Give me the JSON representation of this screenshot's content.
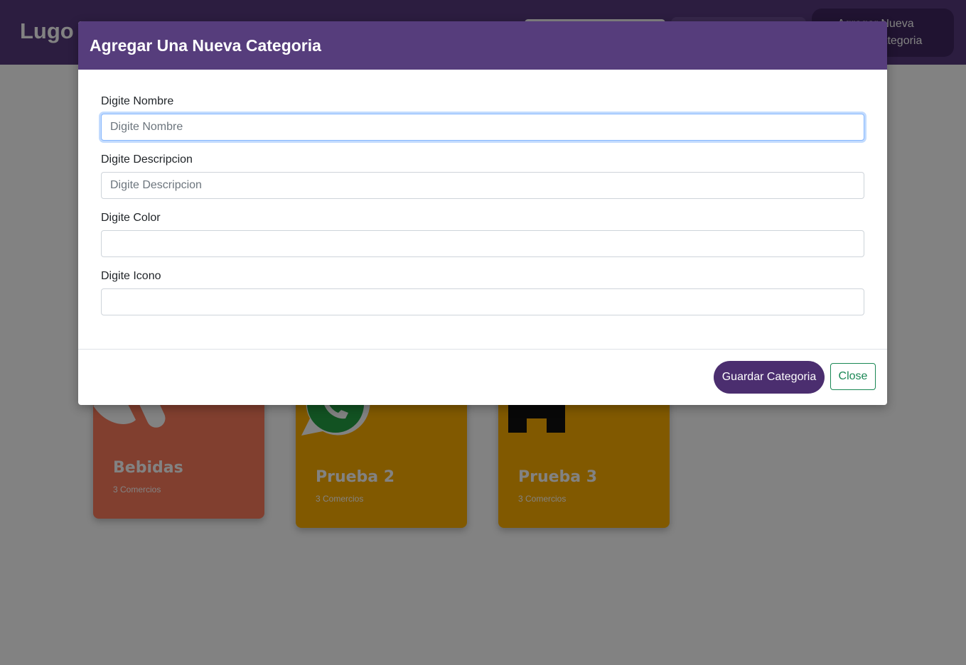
{
  "navbar": {
    "brand": "Lugo",
    "new_button_line1": "Agregar Nueva",
    "new_button_line2": "Categoria"
  },
  "cards": [
    {
      "title": "Bebidas",
      "subtitle": "3 Comercios",
      "color": "#fe7c5c"
    },
    {
      "title": "Prueba 2",
      "subtitle": "3 Comercios",
      "color": "#fdae00",
      "icon": "whatsapp-icon"
    },
    {
      "title": "Prueba 3",
      "subtitle": "3 Comercios",
      "color": "#fdae00",
      "icon": "store-icon"
    }
  ],
  "modal": {
    "title": "Agregar Una Nueva Categoria",
    "fields": {
      "nombre": {
        "label": "Digite Nombre",
        "placeholder": "Digite Nombre",
        "value": ""
      },
      "descripcion": {
        "label": "Digite Descripcion",
        "placeholder": "Digite Descripcion",
        "value": ""
      },
      "color": {
        "label": "Digite Color",
        "placeholder": "",
        "value": ""
      },
      "icono": {
        "label": "Digite Icono",
        "placeholder": "",
        "value": ""
      }
    },
    "save_label": "Guardar Categoria",
    "close_label": "Close"
  },
  "colors": {
    "header": "#563d7c",
    "save_button": "#4b2e6f",
    "close_button": "#198754"
  }
}
